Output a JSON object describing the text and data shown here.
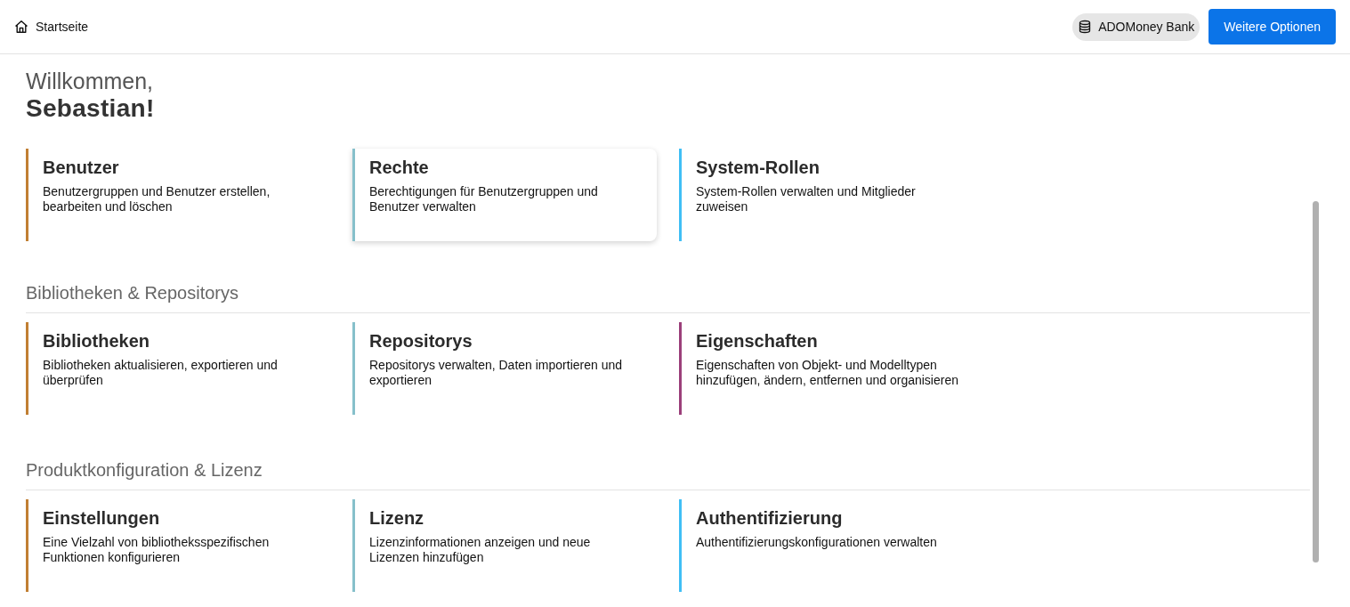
{
  "header": {
    "breadcrumb": {
      "label": "Startseite"
    },
    "tenant": {
      "label": "ADOMoney Bank"
    },
    "action_button": {
      "label": "Weitere Optionen"
    }
  },
  "welcome": {
    "greeting": "Willkommen,",
    "name": "Sebastian!"
  },
  "sections": [
    {
      "cards": [
        {
          "title": "Benutzer",
          "description": "Benutzergruppen und Benutzer erstellen, bearbeiten und löschen",
          "color": "#c17f33",
          "highlighted": false
        },
        {
          "title": "Rechte",
          "description": "Berechtigungen für Benutzergruppen und Benutzer verwalten",
          "color": "#86c0cb",
          "highlighted": true
        },
        {
          "title": "System-Rollen",
          "description": "System-Rollen verwalten und Mitglieder zuweisen",
          "color": "#40bff5",
          "highlighted": false
        }
      ]
    },
    {
      "heading": "Bibliotheken & Repositorys",
      "cards": [
        {
          "title": "Bibliotheken",
          "description": "Bibliotheken aktualisieren, exportieren und überprüfen",
          "color": "#c17f33",
          "highlighted": false
        },
        {
          "title": "Repositorys",
          "description": "Repositorys verwalten, Daten importieren und exportieren",
          "color": "#86c0cb",
          "highlighted": false
        },
        {
          "title": "Eigenschaften",
          "description": "Eigenschaften von Objekt- und Modelltypen hinzufügen, ändern, entfernen und organisieren",
          "color": "#9b3f7a",
          "highlighted": false
        }
      ]
    },
    {
      "heading": "Produktkonfiguration & Lizenz",
      "cards": [
        {
          "title": "Einstellungen",
          "description": "Eine Vielzahl von bibliotheksspezifischen Funktionen konfigurieren",
          "color": "#c17f33",
          "highlighted": false
        },
        {
          "title": "Lizenz",
          "description": "Lizenzinformationen anzeigen und neue Lizenzen hinzufügen",
          "color": "#86c0cb",
          "highlighted": false
        },
        {
          "title": "Authentifizierung",
          "description": "Authentifizierungskonfigurationen verwalten",
          "color": "#40bff5",
          "highlighted": false
        }
      ]
    }
  ]
}
